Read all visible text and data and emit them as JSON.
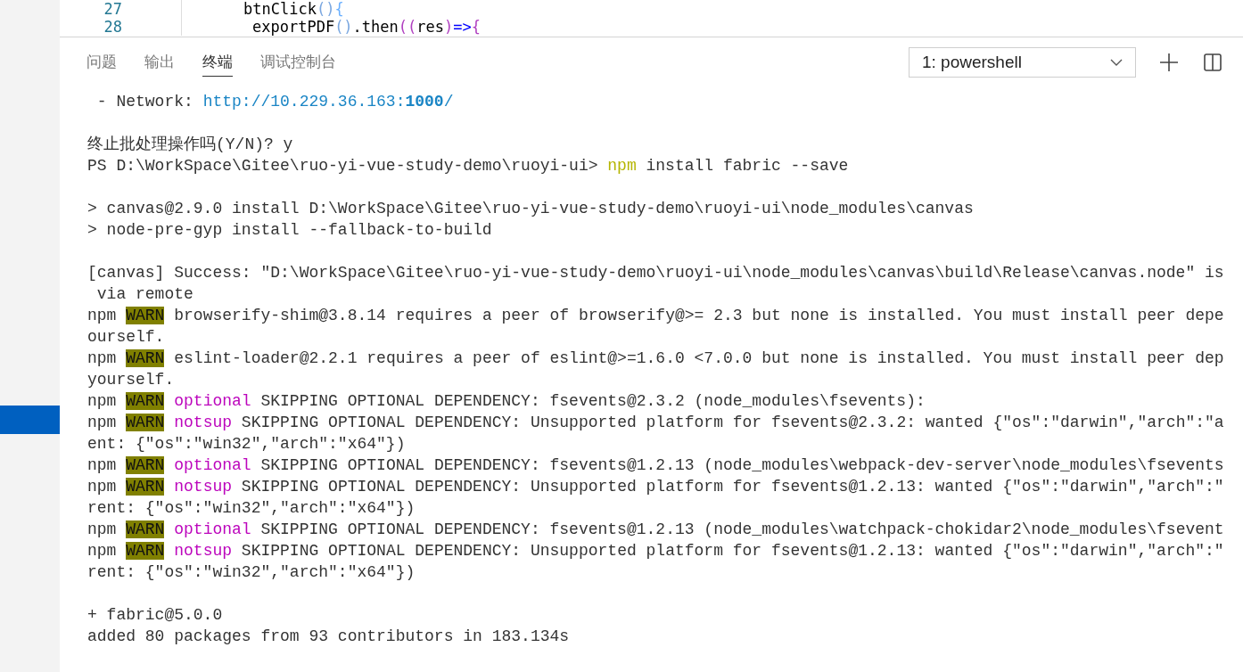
{
  "editor": {
    "lines": [
      {
        "number": "27",
        "segments": [
          {
            "kind": "name",
            "text": "btnClick"
          },
          {
            "kind": "paren",
            "text": "()"
          },
          {
            "kind": "brace",
            "text": "{"
          }
        ]
      },
      {
        "number": "28",
        "segments": [
          {
            "kind": "name",
            "text": "exportPDF"
          },
          {
            "kind": "paren",
            "text": "()"
          },
          {
            "kind": "name",
            "text": ".then"
          },
          {
            "kind": "paren2",
            "text": "(("
          },
          {
            "kind": "name",
            "text": "res"
          },
          {
            "kind": "paren2",
            "text": ")"
          },
          {
            "kind": "arrow",
            "text": "=>"
          },
          {
            "kind": "brace2",
            "text": "{"
          }
        ]
      }
    ]
  },
  "panel": {
    "tabs": [
      {
        "label": "问题",
        "selected": false
      },
      {
        "label": "输出",
        "selected": false
      },
      {
        "label": "终端",
        "selected": true
      },
      {
        "label": "调试控制台",
        "selected": false
      }
    ],
    "terminal_select": {
      "value": "1: powershell"
    },
    "terminal": {
      "blocks": [
        {
          "lines": [
            [
              {
                "kind": "plain",
                "text": " - Network: "
              },
              {
                "kind": "link",
                "text": "http://10.229.36.163:**1000**/"
              }
            ]
          ]
        },
        {
          "lines": [
            [
              {
                "kind": "plain",
                "text": "终止批处理操作吗(Y/N)? y"
              }
            ],
            [
              {
                "kind": "plain",
                "text": "PS D:\\WorkSpace\\Gitee\\ruo-yi-vue-study-demo\\ruoyi-ui> "
              },
              {
                "kind": "command",
                "text": "npm"
              },
              {
                "kind": "plain",
                "text": " install fabric --save"
              }
            ]
          ]
        },
        {
          "lines": [
            [
              {
                "kind": "plain",
                "text": "> canvas@2.9.0 install D:\\WorkSpace\\Gitee\\ruo-yi-vue-study-demo\\ruoyi-ui\\node_modules\\canvas"
              }
            ],
            [
              {
                "kind": "plain",
                "text": "> node-pre-gyp install --fallback-to-build"
              }
            ]
          ]
        },
        {
          "lines": [
            [
              {
                "kind": "plain",
                "text": "[canvas] Success: \"D:\\WorkSpace\\Gitee\\ruo-yi-vue-study-demo\\ruoyi-ui\\node_modules\\canvas\\build\\Release\\canvas.node\" is"
              }
            ],
            [
              {
                "kind": "plain",
                "text": " via remote"
              }
            ],
            [
              {
                "kind": "plain",
                "text": "npm "
              },
              {
                "kind": "warn",
                "text": "WARN"
              },
              {
                "kind": "plain",
                "text": " browserify-shim@3.8.14 requires a peer of browserify@>= 2.3 but none is installed. You must install peer depe"
              }
            ],
            [
              {
                "kind": "plain",
                "text": "ourself."
              }
            ],
            [
              {
                "kind": "plain",
                "text": "npm "
              },
              {
                "kind": "warn",
                "text": "WARN"
              },
              {
                "kind": "plain",
                "text": " eslint-loader@2.2.1 requires a peer of eslint@>=1.6.0 <7.0.0 but none is installed. You must install peer dep"
              }
            ],
            [
              {
                "kind": "plain",
                "text": "yourself."
              }
            ],
            [
              {
                "kind": "plain",
                "text": "npm "
              },
              {
                "kind": "warn",
                "text": "WARN"
              },
              {
                "kind": "tag",
                "text": " optional"
              },
              {
                "kind": "plain",
                "text": " SKIPPING OPTIONAL DEPENDENCY: fsevents@2.3.2 (node_modules\\fsevents):"
              }
            ],
            [
              {
                "kind": "plain",
                "text": "npm "
              },
              {
                "kind": "warn",
                "text": "WARN"
              },
              {
                "kind": "tag",
                "text": " notsup"
              },
              {
                "kind": "plain",
                "text": " SKIPPING OPTIONAL DEPENDENCY: Unsupported platform for fsevents@2.3.2: wanted {\"os\":\"darwin\",\"arch\":\"a"
              }
            ],
            [
              {
                "kind": "plain",
                "text": "ent: {\"os\":\"win32\",\"arch\":\"x64\"})"
              }
            ],
            [
              {
                "kind": "plain",
                "text": "npm "
              },
              {
                "kind": "warn",
                "text": "WARN"
              },
              {
                "kind": "tag",
                "text": " optional"
              },
              {
                "kind": "plain",
                "text": " SKIPPING OPTIONAL DEPENDENCY: fsevents@1.2.13 (node_modules\\webpack-dev-server\\node_modules\\fsevents"
              }
            ],
            [
              {
                "kind": "plain",
                "text": "npm "
              },
              {
                "kind": "warn",
                "text": "WARN"
              },
              {
                "kind": "tag",
                "text": " notsup"
              },
              {
                "kind": "plain",
                "text": " SKIPPING OPTIONAL DEPENDENCY: Unsupported platform for fsevents@1.2.13: wanted {\"os\":\"darwin\",\"arch\":\""
              }
            ],
            [
              {
                "kind": "plain",
                "text": "rent: {\"os\":\"win32\",\"arch\":\"x64\"})"
              }
            ],
            [
              {
                "kind": "plain",
                "text": "npm "
              },
              {
                "kind": "warn",
                "text": "WARN"
              },
              {
                "kind": "tag",
                "text": " optional"
              },
              {
                "kind": "plain",
                "text": " SKIPPING OPTIONAL DEPENDENCY: fsevents@1.2.13 (node_modules\\watchpack-chokidar2\\node_modules\\fsevent"
              }
            ],
            [
              {
                "kind": "plain",
                "text": "npm "
              },
              {
                "kind": "warn",
                "text": "WARN"
              },
              {
                "kind": "tag",
                "text": " notsup"
              },
              {
                "kind": "plain",
                "text": " SKIPPING OPTIONAL DEPENDENCY: Unsupported platform for fsevents@1.2.13: wanted {\"os\":\"darwin\",\"arch\":\""
              }
            ],
            [
              {
                "kind": "plain",
                "text": "rent: {\"os\":\"win32\",\"arch\":\"x64\"})"
              }
            ]
          ]
        },
        {
          "lines": [
            [
              {
                "kind": "plain",
                "text": "+ fabric@5.0.0"
              }
            ],
            [
              {
                "kind": "plain",
                "text": "added 80 packages from 93 contributors in 183.134s"
              }
            ]
          ]
        }
      ]
    }
  }
}
